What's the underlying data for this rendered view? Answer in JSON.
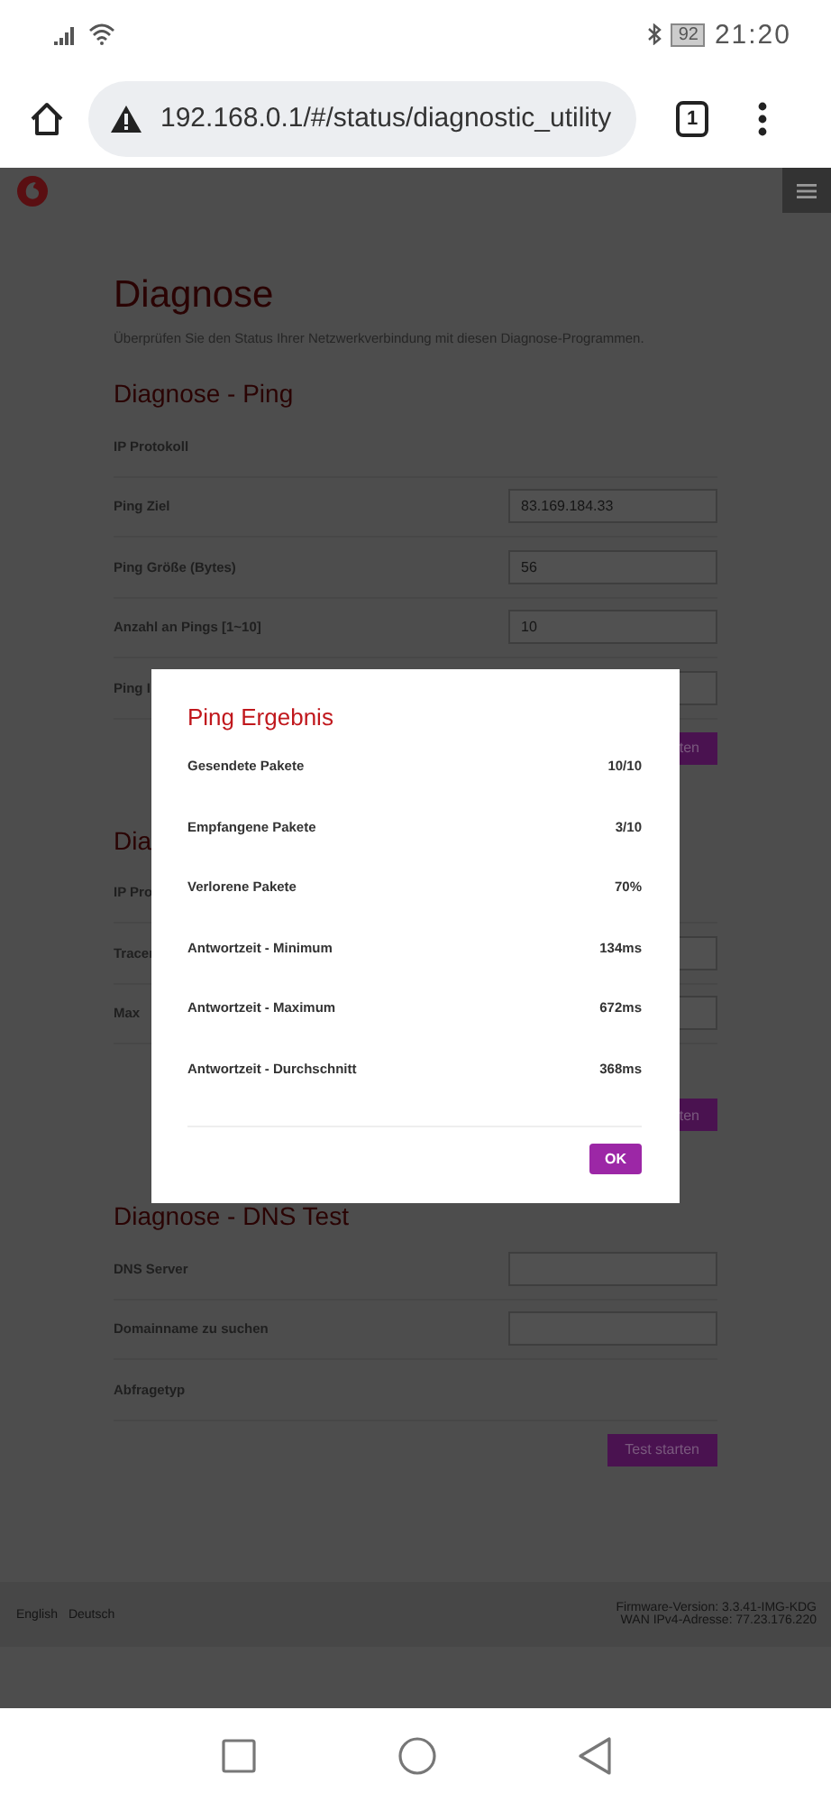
{
  "status_bar": {
    "battery": "92",
    "time": "21:20"
  },
  "browser": {
    "url": "192.168.0.1/#/status/diagnostic_utility",
    "tab_count": "1"
  },
  "page": {
    "title": "Diagnose",
    "description": "Überprüfen Sie den Status Ihrer Netzwerkverbindung mit diesen Diagnose-Programmen.",
    "sections": [
      {
        "title": "Diagnose - Ping",
        "rows": [
          {
            "kind": "text",
            "label": "IP Protokoll"
          },
          {
            "kind": "input",
            "label": "Ping Ziel",
            "value": "83.169.184.33"
          },
          {
            "kind": "input",
            "label": "Ping Größe (Bytes)",
            "value": "56"
          },
          {
            "kind": "input",
            "label": "Anzahl an Pings [1~10]",
            "value": "10"
          },
          {
            "kind": "input",
            "label": "Ping I"
          }
        ],
        "button": "ten"
      },
      {
        "title": "Dia",
        "rows": [
          {
            "kind": "text",
            "label": "IP Pro"
          },
          {
            "kind": "input",
            "label": "Tracer"
          },
          {
            "kind": "input",
            "label": "Max"
          }
        ],
        "button": "ten"
      },
      {
        "title": "Diagnose - DNS Test",
        "rows": [
          {
            "kind": "input",
            "label": "DNS Server"
          },
          {
            "kind": "input",
            "label": "Domainname zu suchen"
          },
          {
            "kind": "text",
            "label": "Abfragetyp"
          }
        ],
        "button": "Test starten"
      }
    ]
  },
  "modal": {
    "title": "Ping Ergebnis",
    "rows": [
      {
        "label": "Gesendete Pakete",
        "value": "10/10"
      },
      {
        "label": "Empfangene Pakete",
        "value": "3/10"
      },
      {
        "label": "Verlorene Pakete",
        "value": "70%"
      },
      {
        "label": "Antwortzeit - Minimum",
        "value": "134ms"
      },
      {
        "label": "Antwortzeit - Maximum",
        "value": "672ms"
      },
      {
        "label": "Antwortzeit - Durchschnitt",
        "value": "368ms"
      }
    ],
    "button": "OK"
  },
  "footer": {
    "links": [
      "English",
      "Deutsch"
    ],
    "info": [
      "Firmware-Version: 3.3.41-IMG-KDG",
      "WAN IPv4-Adresse: 77.23.176.220"
    ]
  }
}
